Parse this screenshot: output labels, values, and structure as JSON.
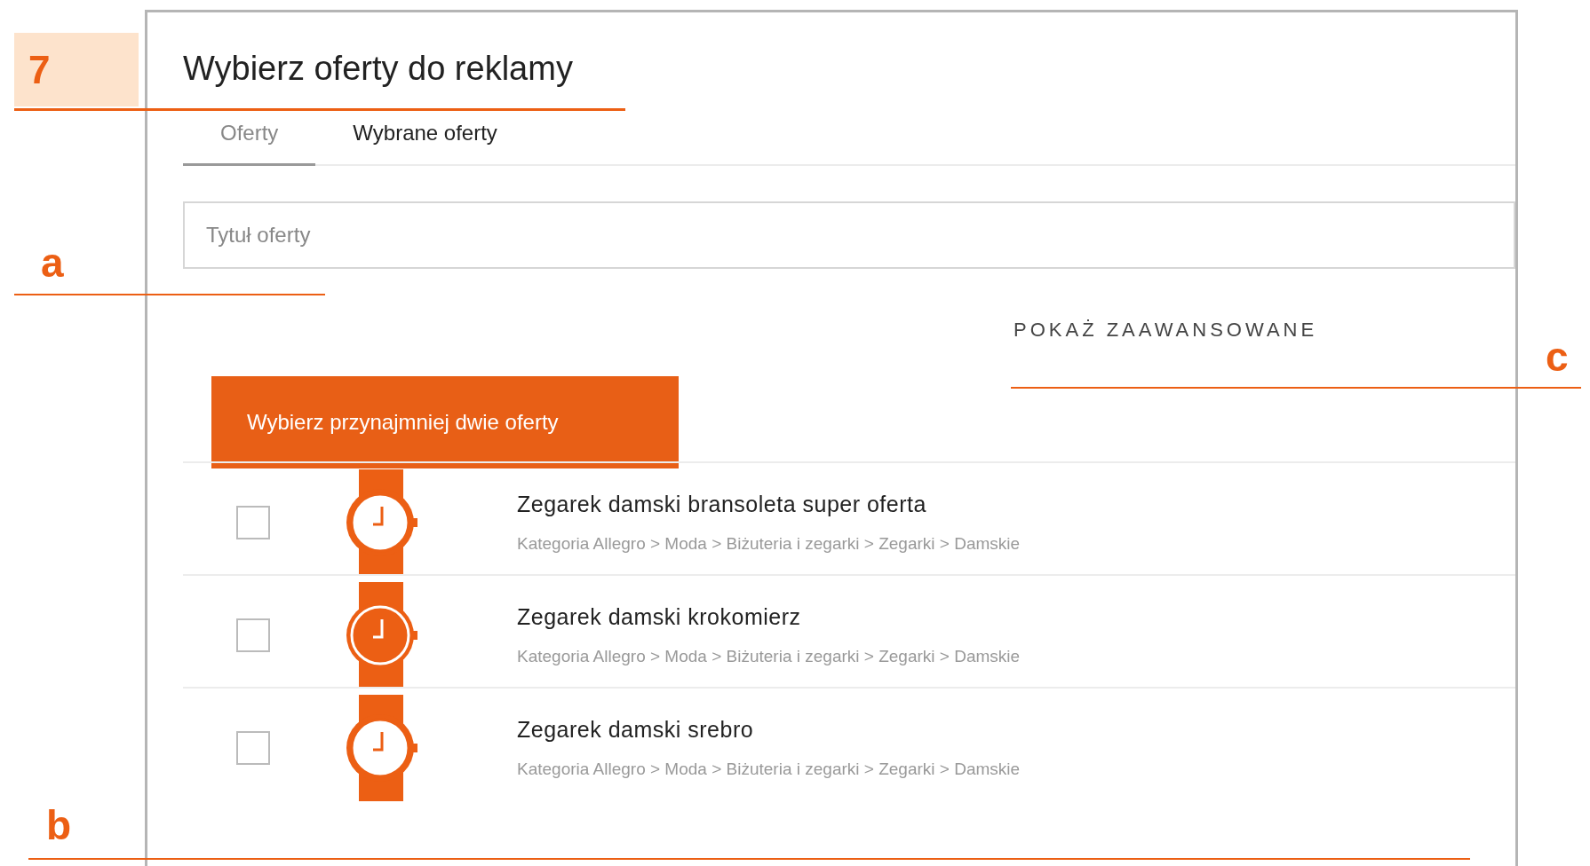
{
  "step_badge": "7",
  "callouts": [
    {
      "label": "a"
    },
    {
      "label": "c"
    },
    {
      "label": "b"
    }
  ],
  "title": "Wybierz oferty do reklamy",
  "tabs": [
    {
      "label": "Oferty",
      "selected": true
    },
    {
      "label": "Wybrane oferty",
      "selected": false
    }
  ],
  "search": {
    "placeholder": "Tytuł oferty"
  },
  "advanced_link": "POKAŻ ZAAWANSOWANE",
  "notice": "Wybierz przynajmniej dwie oferty",
  "offers": [
    {
      "title": "Zegarek damski bransoleta super oferta",
      "category": "Kategoria Allegro > Moda > Biżuteria i zegarki > Zegarki > Damskie",
      "checked": false,
      "kind": "outline"
    },
    {
      "title": "Zegarek damski krokomierz",
      "category": "Kategoria Allegro > Moda > Biżuteria i zegarki > Zegarki > Damskie",
      "checked": false,
      "kind": "filled"
    },
    {
      "title": "Zegarek damski srebro",
      "category": "Kategoria Allegro > Moda > Biżuteria i zegarki > Zegarki > Damskie",
      "checked": false,
      "kind": "outline"
    }
  ]
}
